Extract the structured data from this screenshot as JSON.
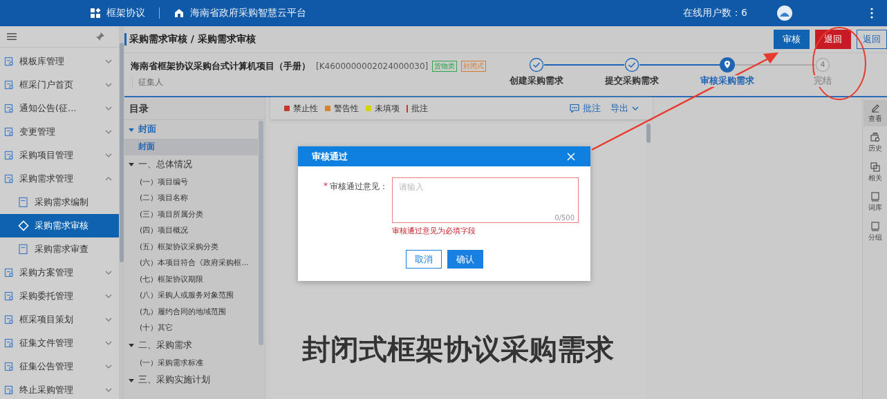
{
  "header": {
    "module": "框架协议",
    "platform": "海南省政府采购智慧云平台",
    "online_users": "在线用户数：6"
  },
  "sidebar": {
    "items": [
      {
        "label": "模板库管理",
        "expanded": false
      },
      {
        "label": "框采门户首页",
        "expanded": false
      },
      {
        "label": "通知公告(征...",
        "expanded": false
      },
      {
        "label": "变更管理",
        "expanded": false
      },
      {
        "label": "采购项目管理",
        "expanded": false
      },
      {
        "label": "采购需求管理",
        "expanded": true,
        "children": [
          {
            "label": "采购需求编制",
            "selected": false
          },
          {
            "label": "采购需求审核",
            "selected": true
          },
          {
            "label": "采购需求审查",
            "selected": false
          }
        ]
      },
      {
        "label": "采购方案管理",
        "expanded": false
      },
      {
        "label": "采购委托管理",
        "expanded": false
      },
      {
        "label": "框采项目策划",
        "expanded": false
      },
      {
        "label": "征集文件管理",
        "expanded": false
      },
      {
        "label": "征集公告管理",
        "expanded": false
      },
      {
        "label": "终止采购管理",
        "expanded": false
      }
    ]
  },
  "breadcrumb": "采购需求审核 / 采购需求审核",
  "actions": [
    {
      "label": "审核",
      "kind": "primary"
    },
    {
      "label": "退回",
      "kind": "danger"
    },
    {
      "label": "返回",
      "kind": "outline"
    }
  ],
  "project": {
    "title": "海南省框架协议采购台式计算机项目（手册）",
    "code": "[K4600000002024000030]",
    "tags": [
      {
        "label": "货物类",
        "color": "#2ea44f"
      },
      {
        "label": "封闭式",
        "color": "#d97a2b"
      }
    ],
    "collector_label": "征集人"
  },
  "steps": [
    {
      "label": "创建采购需求",
      "kind": "done"
    },
    {
      "label": "提交采购需求",
      "kind": "done"
    },
    {
      "label": "审核采购需求",
      "kind": "current"
    },
    {
      "label": "完结",
      "kind": "pending",
      "number": "4"
    }
  ],
  "toc": {
    "title": "目录",
    "items": [
      {
        "label": "封面",
        "expanded": true,
        "children": [
          {
            "label": "封面",
            "selected": true
          }
        ]
      },
      {
        "label": "一、总体情况",
        "expanded": true,
        "children": [
          {
            "label": "(一）项目编号",
            "selected": false
          },
          {
            "label": "(二）项目名称",
            "selected": false
          },
          {
            "label": "(三）项目所属分类",
            "selected": false
          },
          {
            "label": "(四）项目概况",
            "selected": false
          },
          {
            "label": "(五）框架协议采购分类",
            "selected": false
          },
          {
            "label": "(六）本项目符合《政府采购框...",
            "selected": false
          },
          {
            "label": "(七）框架协议期限",
            "selected": false
          },
          {
            "label": "(八）采购人或服务对象范围",
            "selected": false
          },
          {
            "label": "(九）履约合同的地域范围",
            "selected": false
          },
          {
            "label": "(十）其它",
            "selected": false
          }
        ]
      },
      {
        "label": "二、采购需求",
        "expanded": true,
        "children": [
          {
            "label": "(一）采购需求标准",
            "selected": false
          }
        ]
      },
      {
        "label": "三、采购实施计划",
        "expanded": true
      }
    ]
  },
  "legend": [
    {
      "label": "禁止性",
      "kind": "square",
      "color": "#c0392b"
    },
    {
      "label": "警告性",
      "kind": "square",
      "color": "#d9822b"
    },
    {
      "label": "未填项",
      "kind": "square",
      "color": "#d4d400"
    },
    {
      "label": "批注",
      "kind": "bar",
      "color": "#c0392b"
    }
  ],
  "doc_tools": [
    {
      "label": "批注",
      "kind": "comment"
    },
    {
      "label": "导出",
      "kind": "dropdown"
    }
  ],
  "document_title": "封闭式框架协议采购需求",
  "right_tools": [
    {
      "label": "查看",
      "kind": "pen",
      "selected": true
    },
    {
      "label": "历史",
      "kind": "history",
      "selected": false
    },
    {
      "label": "相关",
      "kind": "copy",
      "selected": false
    },
    {
      "label": "词库",
      "kind": "book",
      "selected": false
    },
    {
      "label": "分组",
      "kind": "book",
      "selected": false
    }
  ],
  "dialog": {
    "title": "审核通过",
    "field_label": "审核通过意见：",
    "required_mark": "*",
    "placeholder": "请输入",
    "counter": "0/500",
    "error": "审核通过意见为必填字段",
    "buttons": [
      {
        "label": "取消",
        "kind": "secondary"
      },
      {
        "label": "确认",
        "kind": "primary"
      }
    ]
  }
}
